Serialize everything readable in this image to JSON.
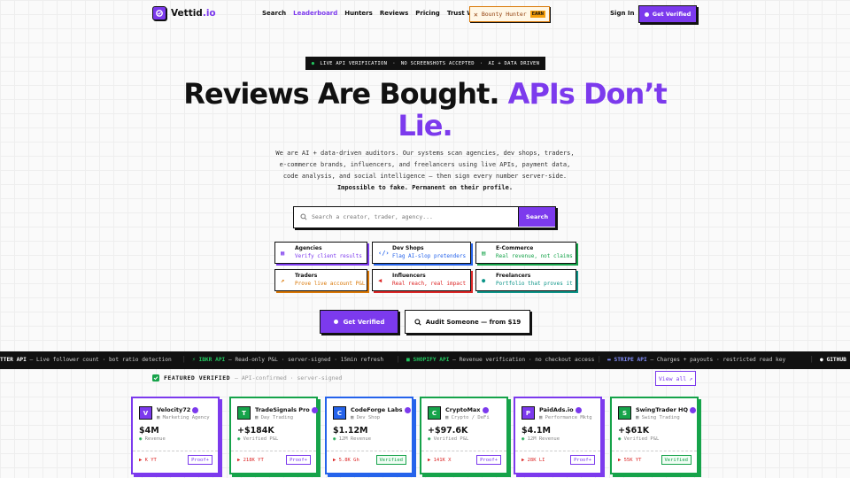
{
  "header": {
    "logo_main": "Vettid",
    "logo_suffix": ".io",
    "nav": [
      "Search",
      "Leaderboard",
      "Hunters",
      "Reviews",
      "Pricing",
      "Trust Widget"
    ],
    "bounty_label": "Bounty Hunter",
    "bounty_badge": "EARN",
    "signin": "Sign In",
    "get_verified": "Get Verified"
  },
  "tagbar": {
    "items": [
      "LIVE API VERIFICATION",
      "·",
      "NO SCREENSHOTS ACCEPTED",
      "·",
      "AI + DATA DRIVEN"
    ]
  },
  "hero": {
    "headline_black": "Reviews Are Bought.",
    "headline_purple": "APIs Don’t Lie.",
    "sub_plain": "We are AI + data-driven auditors. Our systems scan agencies, dev shops, traders, e-commerce brands, influencers, and freelancers using live APIs, payment data, code analysis, and social intelligence — then sign every number server-side.",
    "sub_bold": "Impossible to fake. Permanent on their profile."
  },
  "search": {
    "placeholder": "Search a creator, trader, agency...",
    "button": "Search"
  },
  "categories": [
    {
      "title": "Agencies",
      "sub": "Verify client results",
      "color": "#7c3aed",
      "shadow": "#7c3aed",
      "icon": "building-icon"
    },
    {
      "title": "Dev Shops",
      "sub": "Flag AI-slop pretenders",
      "color": "#2563eb",
      "shadow": "#2563eb",
      "icon": "code-icon"
    },
    {
      "title": "E-Commerce",
      "sub": "Real revenue, not claims",
      "color": "#16a34a",
      "shadow": "#16a34a",
      "icon": "store-icon"
    },
    {
      "title": "Traders",
      "sub": "Prove live account P&L",
      "color": "#d97706",
      "shadow": "#d97706",
      "icon": "chart-icon"
    },
    {
      "title": "Influencers",
      "sub": "Real reach, real impact",
      "color": "#dc2626",
      "shadow": "#dc2626",
      "icon": "megaphone-icon"
    },
    {
      "title": "Freelancers",
      "sub": "Portfolio that proves it",
      "color": "#0d9488",
      "shadow": "#0d9488",
      "icon": "user-icon"
    }
  ],
  "cta": {
    "primary": "Get Verified",
    "secondary": "Audit Someone — from $19"
  },
  "ticker": [
    {
      "name": "TTER API",
      "desc": " — Live follower count · bot ratio detection",
      "color": "#ffffff",
      "icon": ""
    },
    {
      "name": "IBKR API",
      "desc": " — Read-only P&L · server-signed · 15min refresh",
      "color": "#22c55e",
      "icon": "bolt-icon"
    },
    {
      "name": "SHOPIFY API",
      "desc": " — Revenue verification · no checkout access",
      "color": "#22c55e",
      "icon": "bag-icon"
    },
    {
      "name": "STRIPE API",
      "desc": " — Charges + payouts · restricted read key",
      "color": "#818cf8",
      "icon": "card-icon"
    },
    {
      "name": "GITHUB",
      "desc": "",
      "color": "#ffffff",
      "icon": "github-icon"
    }
  ],
  "featured": {
    "label": "FEATURED VERIFIED",
    "meta": "— API-confirmed · server-signed",
    "view_all": "View all"
  },
  "cards": [
    {
      "initial": "V",
      "name": "Velocity72",
      "type": "Marketing Agency",
      "value": "$4M",
      "metric": "Revenue",
      "stat": "K YT",
      "badge": "Proof+",
      "ok": false,
      "border": "#7c3aed",
      "av": "#7c3aed"
    },
    {
      "initial": "T",
      "name": "TradeSignals Pro",
      "type": "Day Trading",
      "value": "+$184K",
      "metric": "Verified P&L",
      "stat": "218K YT",
      "badge": "Proof+",
      "ok": false,
      "border": "#16a34a",
      "av": "#16a34a"
    },
    {
      "initial": "C",
      "name": "CodeForge Labs",
      "type": "Dev Shop",
      "value": "$1.12M",
      "metric": "12M Revenue",
      "stat": "5.8K Gh",
      "badge": "Verified",
      "ok": true,
      "border": "#2563eb",
      "av": "#2563eb"
    },
    {
      "initial": "C",
      "name": "CryptoMax",
      "type": "Crypto / DeFi",
      "value": "+$97.6K",
      "metric": "Verified P&L",
      "stat": "141K X",
      "badge": "Proof+",
      "ok": false,
      "border": "#16a34a",
      "av": "#16a34a"
    },
    {
      "initial": "P",
      "name": "PaidAds.io",
      "type": "Performance Mktg",
      "value": "$4.1M",
      "metric": "12M Revenue",
      "stat": "28K LI",
      "badge": "Proof+",
      "ok": false,
      "border": "#7c3aed",
      "av": "#7c3aed"
    },
    {
      "initial": "S",
      "name": "SwingTrader HQ",
      "type": "Swing Trading",
      "value": "+$61K",
      "metric": "Verified P&L",
      "stat": "55K YT",
      "badge": "Verified",
      "ok": true,
      "border": "#16a34a",
      "av": "#16a34a"
    }
  ]
}
